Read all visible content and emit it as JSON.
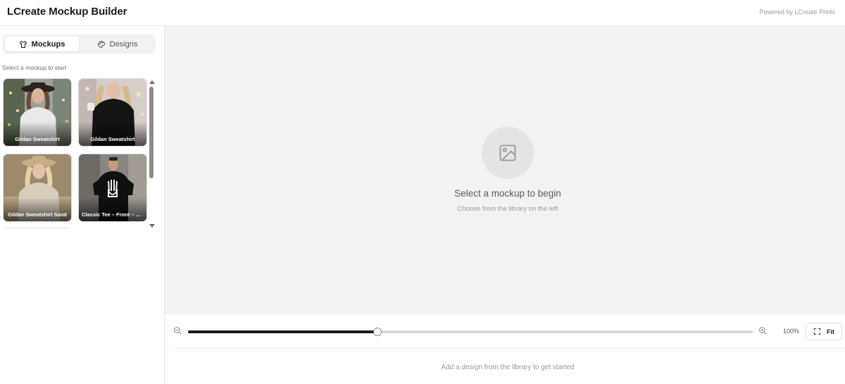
{
  "app": {
    "title": "LCreate Mockup Builder",
    "powered_by": "Powered by LCreate Prints"
  },
  "sidebar": {
    "tabs": [
      {
        "label": "Mockups",
        "icon": "shirt-icon",
        "active": true
      },
      {
        "label": "Designs",
        "icon": "palette-icon",
        "active": false
      }
    ],
    "hint": "Select a mockup to start",
    "mockups": [
      {
        "label": "Gildan Sweatshirt",
        "shirt_color": "#e9e9e7"
      },
      {
        "label": "Gildan Sweatshirt",
        "shirt_color": "#141414"
      },
      {
        "label": "Gildan Sweatshirt Sand",
        "shirt_color": "#d8ccbd"
      },
      {
        "label": "Classic Tee – Front – Bl...",
        "shirt_color": "#111111"
      }
    ]
  },
  "canvas": {
    "empty_title": "Select a mockup to begin",
    "empty_subtitle": "Choose from the library on the left"
  },
  "toolbar": {
    "zoom_percent": "100%",
    "zoom_slider_fraction": 0.335,
    "fit_label": "Fit",
    "footer_hint": "Add a design from the library to get started"
  }
}
